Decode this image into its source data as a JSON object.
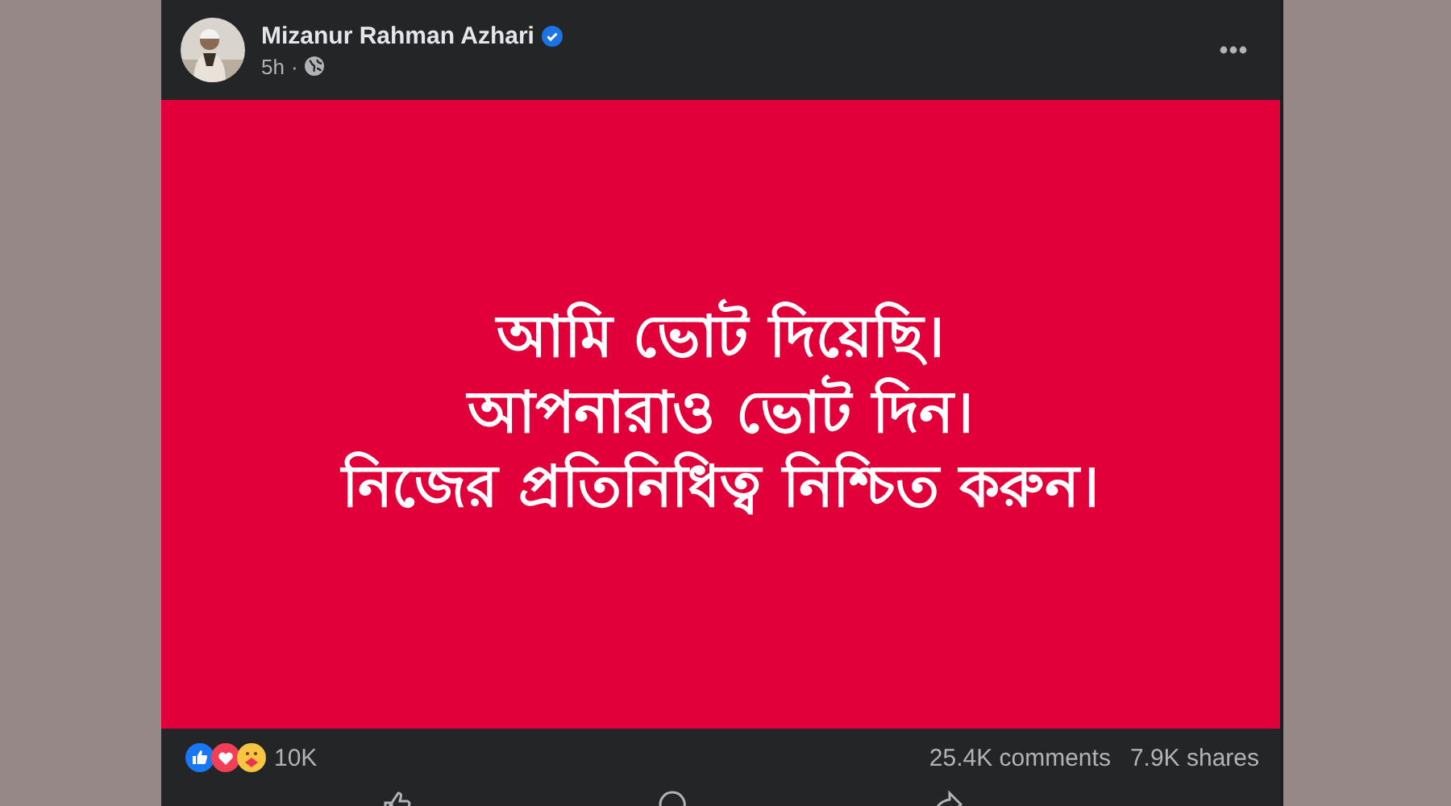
{
  "post": {
    "author": "Mizanur Rahman Azhari",
    "verified": true,
    "time": "5h",
    "separator": "·",
    "lines": [
      "আমি ভোট দিয়েছি।",
      "আপনারাও ভোট দিন।",
      "নিজের প্রতিনিধিত্ব নিশ্চিত করুন।"
    ],
    "reactions_count": "10K",
    "comments": "25.4K comments",
    "shares": "7.9K shares",
    "actions": [
      {
        "kind": "like"
      },
      {
        "kind": "comment"
      },
      {
        "kind": "share"
      }
    ]
  }
}
